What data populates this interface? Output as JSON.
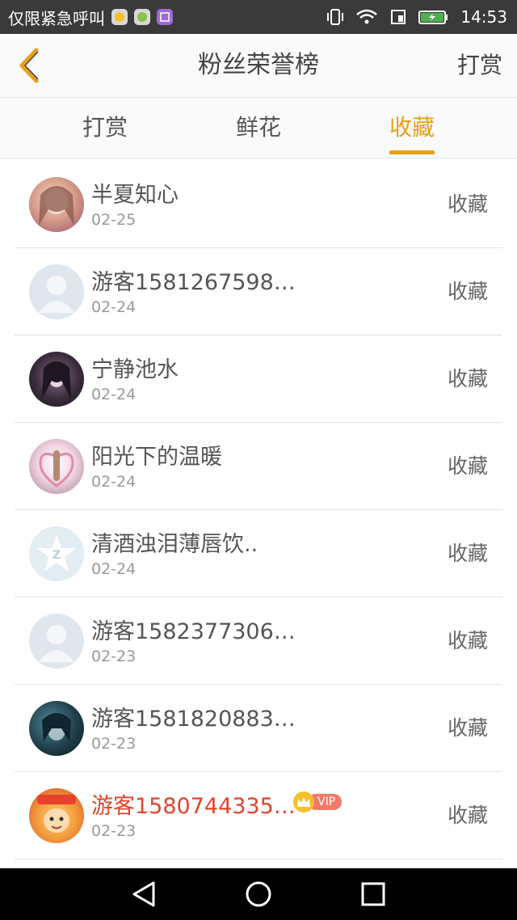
{
  "status_bar": {
    "carrier_text": "仅限紧急呼叫",
    "time": "14:53"
  },
  "nav": {
    "title": "粉丝荣誉榜",
    "action": "打赏"
  },
  "tabs": [
    {
      "label": "打赏",
      "active": false
    },
    {
      "label": "鲜花",
      "active": false
    },
    {
      "label": "收藏",
      "active": true
    }
  ],
  "accent_color": "#e8a01a",
  "list": [
    {
      "name": "半夏知心",
      "date": "02-25",
      "action": "收藏",
      "avatar": "photo"
    },
    {
      "name": "游客1581267598…",
      "date": "02-24",
      "action": "收藏",
      "avatar": "default"
    },
    {
      "name": "宁静池水",
      "date": "02-24",
      "action": "收藏",
      "avatar": "photo"
    },
    {
      "name": "阳光下的温暖",
      "date": "02-24",
      "action": "收藏",
      "avatar": "photo"
    },
    {
      "name": "清酒浊泪薄唇饮..",
      "date": "02-24",
      "action": "收藏",
      "avatar": "qq"
    },
    {
      "name": "游客1582377306…",
      "date": "02-23",
      "action": "收藏",
      "avatar": "default"
    },
    {
      "name": "游客1581820883…",
      "date": "02-23",
      "action": "收藏",
      "avatar": "photo"
    },
    {
      "name": "游客1580744335…",
      "date": "02-23",
      "action": "收藏",
      "avatar": "photo",
      "vip": "VIP"
    }
  ]
}
